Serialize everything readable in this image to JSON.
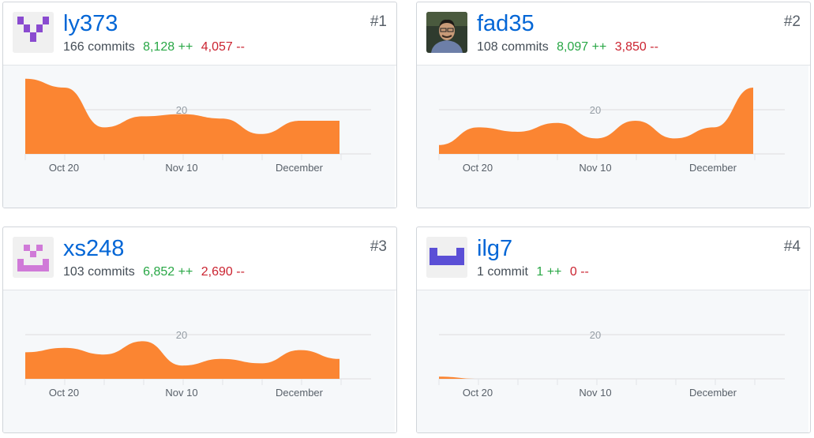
{
  "contributors": [
    {
      "username": "ly373",
      "commits": "166 commits",
      "additions": "8,128 ++",
      "deletions": "4,057 --",
      "rank": "#1",
      "avatar": "identicon-purple-v",
      "chart": [
        34,
        30,
        12,
        17,
        18,
        16,
        9,
        15,
        15
      ],
      "x_labels": [
        "Oct 20",
        "Nov 10",
        "December"
      ],
      "y_label": "20"
    },
    {
      "username": "fad35",
      "commits": "108 commits",
      "additions": "8,097 ++",
      "deletions": "3,850 --",
      "rank": "#2",
      "avatar": "photo-person",
      "chart": [
        4,
        12,
        10,
        14,
        7,
        15,
        7,
        12,
        30
      ],
      "x_labels": [
        "Oct 20",
        "Nov 10",
        "December"
      ],
      "y_label": "20"
    },
    {
      "username": "xs248",
      "commits": "103 commits",
      "additions": "6,852 ++",
      "deletions": "2,690 --",
      "rank": "#3",
      "avatar": "identicon-pink-smile",
      "chart": [
        12,
        14,
        11,
        17,
        6,
        9,
        7,
        13,
        9
      ],
      "x_labels": [
        "Oct 20",
        "Nov 10",
        "December"
      ],
      "y_label": "20"
    },
    {
      "username": "ilg7",
      "commits": "1 commit",
      "additions": "1 ++",
      "deletions": "0 --",
      "rank": "#4",
      "avatar": "identicon-blue-bar",
      "chart": [
        1,
        0,
        0,
        0,
        0,
        0,
        0,
        0,
        0
      ],
      "x_labels": [
        "Oct 20",
        "Nov 10",
        "December"
      ],
      "y_label": "20"
    }
  ],
  "colors": {
    "accent": "#fb8532",
    "link": "#0366d6",
    "add": "#28a745",
    "del": "#cb2431"
  }
}
